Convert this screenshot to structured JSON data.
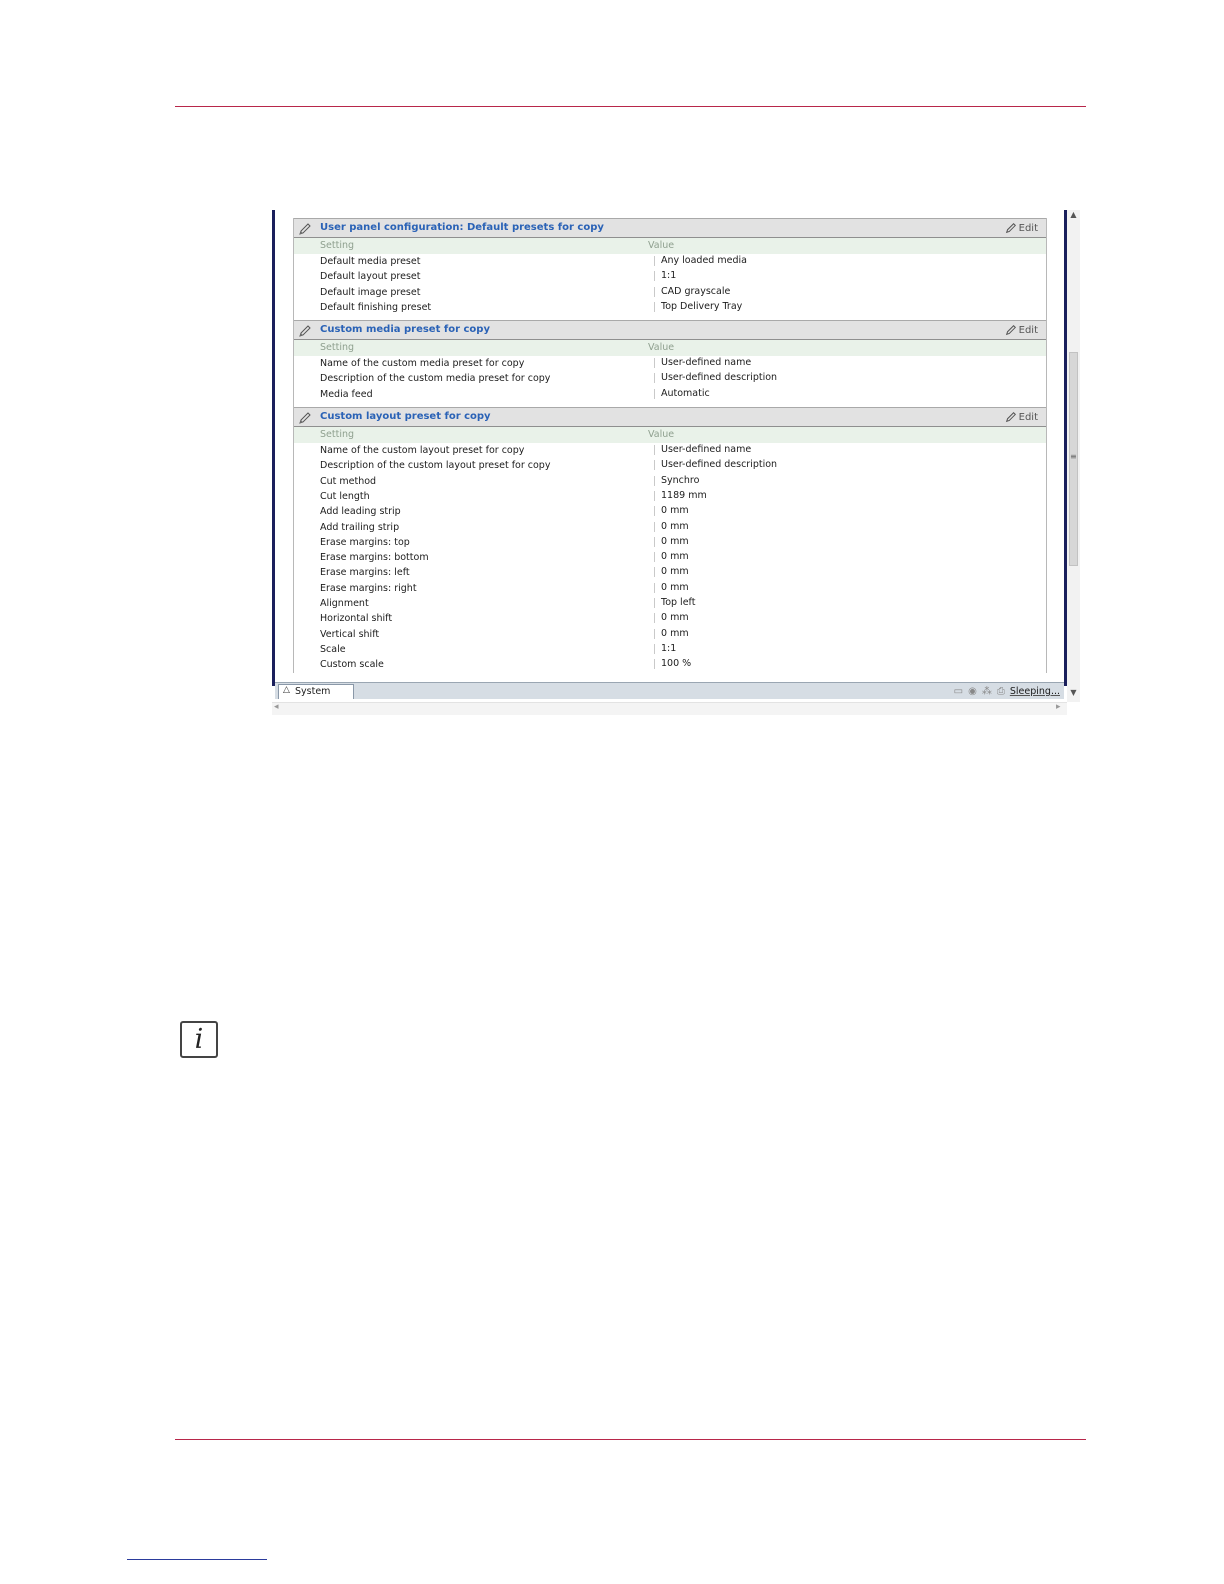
{
  "document": {
    "info_glyph": "i"
  },
  "app": {
    "column_setting": "Setting",
    "column_value": "Value",
    "edit_label": "Edit",
    "sections": [
      {
        "title": "User panel configuration: Default presets for copy",
        "rows": [
          {
            "setting": "Default media preset",
            "value": "Any loaded media"
          },
          {
            "setting": "Default layout preset",
            "value": "1:1"
          },
          {
            "setting": "Default image preset",
            "value": "CAD grayscale"
          },
          {
            "setting": "Default finishing preset",
            "value": "Top Delivery Tray"
          }
        ]
      },
      {
        "title": "Custom media preset for copy",
        "rows": [
          {
            "setting": "Name of the custom media preset for copy",
            "value": "User-defined name"
          },
          {
            "setting": "Description of the custom media preset for copy",
            "value": "User-defined description"
          },
          {
            "setting": "Media feed",
            "value": "Automatic"
          }
        ]
      },
      {
        "title": "Custom layout preset for copy",
        "rows": [
          {
            "setting": "Name of the custom layout preset for copy",
            "value": "User-defined name"
          },
          {
            "setting": "Description of the custom layout preset for copy",
            "value": "User-defined description"
          },
          {
            "setting": "Cut method",
            "value": "Synchro"
          },
          {
            "setting": "Cut length",
            "value": "1189 mm"
          },
          {
            "setting": "Add leading strip",
            "value": "0 mm"
          },
          {
            "setting": "Add trailing strip",
            "value": "0 mm"
          },
          {
            "setting": "Erase margins: top",
            "value": "0 mm"
          },
          {
            "setting": "Erase margins: bottom",
            "value": "0 mm"
          },
          {
            "setting": "Erase margins: left",
            "value": "0 mm"
          },
          {
            "setting": "Erase margins: right",
            "value": "0 mm"
          },
          {
            "setting": "Alignment",
            "value": "Top left"
          },
          {
            "setting": "Horizontal shift",
            "value": "0 mm"
          },
          {
            "setting": "Vertical shift",
            "value": "0 mm"
          },
          {
            "setting": "Scale",
            "value": "1:1"
          },
          {
            "setting": "Custom scale",
            "value": "100 %"
          }
        ]
      }
    ],
    "statusbar": {
      "tab_label": "System",
      "status_text": "Sleeping..."
    }
  },
  "colors": {
    "accent_rule": "#b8274a",
    "section_title": "#2a62b6"
  }
}
